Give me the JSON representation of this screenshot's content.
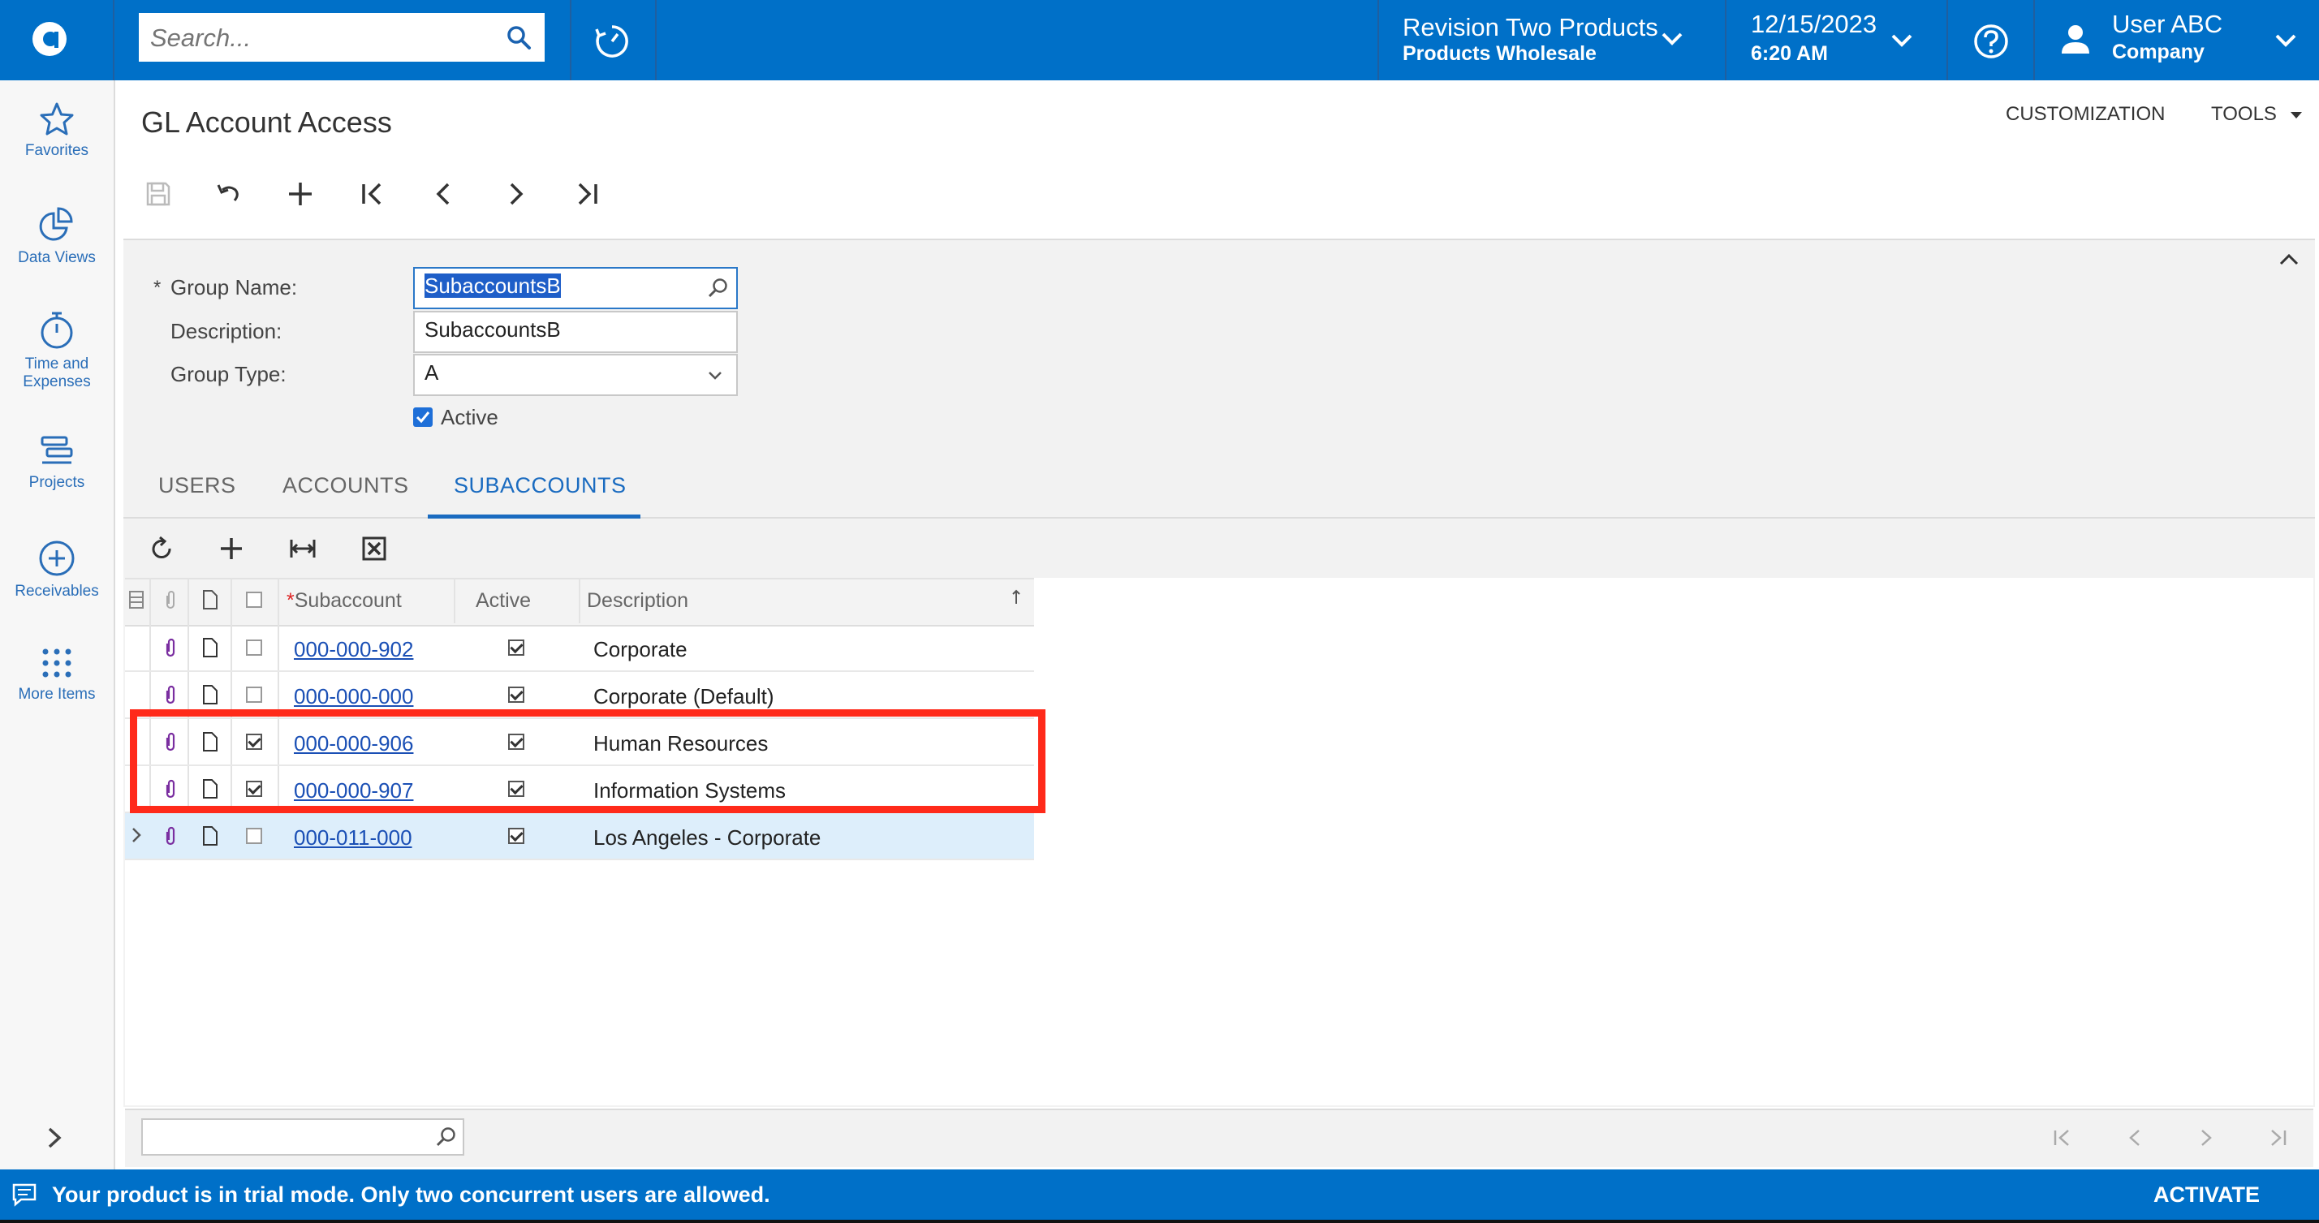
{
  "topbar": {
    "search_placeholder": "Search...",
    "branch_title": "Revision Two Products",
    "branch_subtitle": "Products Wholesale",
    "date": "12/15/2023",
    "time": "6:20 AM",
    "user_name": "User ABC",
    "user_company": "Company"
  },
  "sidebar": {
    "items": [
      {
        "label": "Favorites",
        "icon": "star-icon"
      },
      {
        "label": "Data Views",
        "icon": "pie-chart-icon"
      },
      {
        "label_line1": "Time and",
        "label_line2": "Expenses",
        "icon": "stopwatch-icon"
      },
      {
        "label": "Projects",
        "icon": "projects-icon"
      },
      {
        "label": "Receivables",
        "icon": "plus-circle-icon"
      },
      {
        "label": "More Items",
        "icon": "grid-dots-icon"
      }
    ]
  },
  "page": {
    "title": "GL Account Access",
    "customization_label": "CUSTOMIZATION",
    "tools_label": "TOOLS"
  },
  "form": {
    "group_name_label": "Group Name:",
    "group_name_value": "SubaccountsB",
    "description_label": "Description:",
    "description_value": "SubaccountsB",
    "group_type_label": "Group Type:",
    "group_type_value": "A",
    "active_label": "Active",
    "active_checked": true
  },
  "tabs": [
    "USERS",
    "ACCOUNTS",
    "SUBACCOUNTS"
  ],
  "active_tab": "SUBACCOUNTS",
  "grid": {
    "columns": {
      "subaccount": "Subaccount",
      "active": "Active",
      "description": "Description"
    },
    "rows": [
      {
        "selected": false,
        "subaccount": "000-000-902",
        "active": true,
        "description": "Corporate"
      },
      {
        "selected": false,
        "subaccount": "000-000-000",
        "active": true,
        "description": "Corporate (Default)"
      },
      {
        "selected": true,
        "subaccount": "000-000-906",
        "active": true,
        "description": "Human Resources"
      },
      {
        "selected": true,
        "subaccount": "000-000-907",
        "active": true,
        "description": "Information Systems"
      },
      {
        "selected": false,
        "subaccount": "000-011-000",
        "active": true,
        "description": "Los Angeles - Corporate"
      }
    ]
  },
  "footer": {
    "trial_message": "Your product is in trial mode. Only two concurrent users are allowed.",
    "activate_label": "ACTIVATE"
  },
  "colors": {
    "brand_blue": "#0070c8",
    "highlight_red": "#ff2a1a",
    "link_blue": "#1a4fb5"
  }
}
